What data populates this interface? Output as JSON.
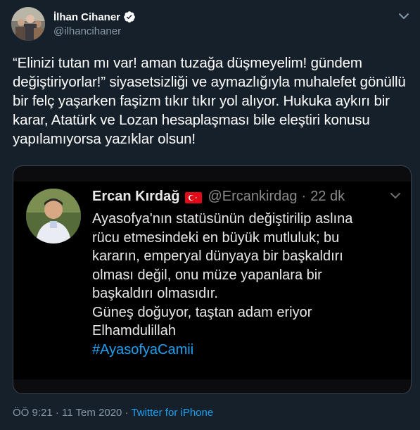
{
  "author": {
    "name": "İlhan Cihaner",
    "handle": "@ilhancihaner",
    "verified": true
  },
  "tweet": {
    "text": "“Elinizi tutan mı var! aman tuzağa düşmeyelim! gündem değiştiriyorlar!” siyasetsizliği ve aymazlığıyla muhalefet gönüllü bir felç yaşarken faşizm tıkır tıkır yol alıyor. Hukuka aykırı bir karar, Atatürk ve Lozan hesaplaşması bile eleştiri konusu yapılamıyorsa yazıklar olsun!"
  },
  "quoted": {
    "name": "Ercan Kırdağ",
    "flag": "turkey-flag",
    "handle": "@Ercankirdag",
    "separator": "·",
    "time": "22 dk",
    "lines": [
      "Ayasofya'nın statüsünün değiştirilip aslına",
      "rücu etmesindeki en büyük mutluluk; bu",
      "kararın, emperyal dünyaya bir başkaldırı",
      "olması değil, onu müze yapanlara bir",
      "başkaldırı olmasıdır.",
      "Güneş doğuyor, taştan adam eriyor",
      "Elhamdulillah"
    ],
    "hashtag": "#AyasofyaCamii"
  },
  "meta": {
    "time": "ÖÖ 9:21",
    "separator1": "·",
    "date": "11 Tem 2020",
    "separator2": "·",
    "source": "Twitter for iPhone"
  },
  "colors": {
    "background": "#15202b",
    "accent": "#1da1f2",
    "muted": "#8899a6"
  }
}
